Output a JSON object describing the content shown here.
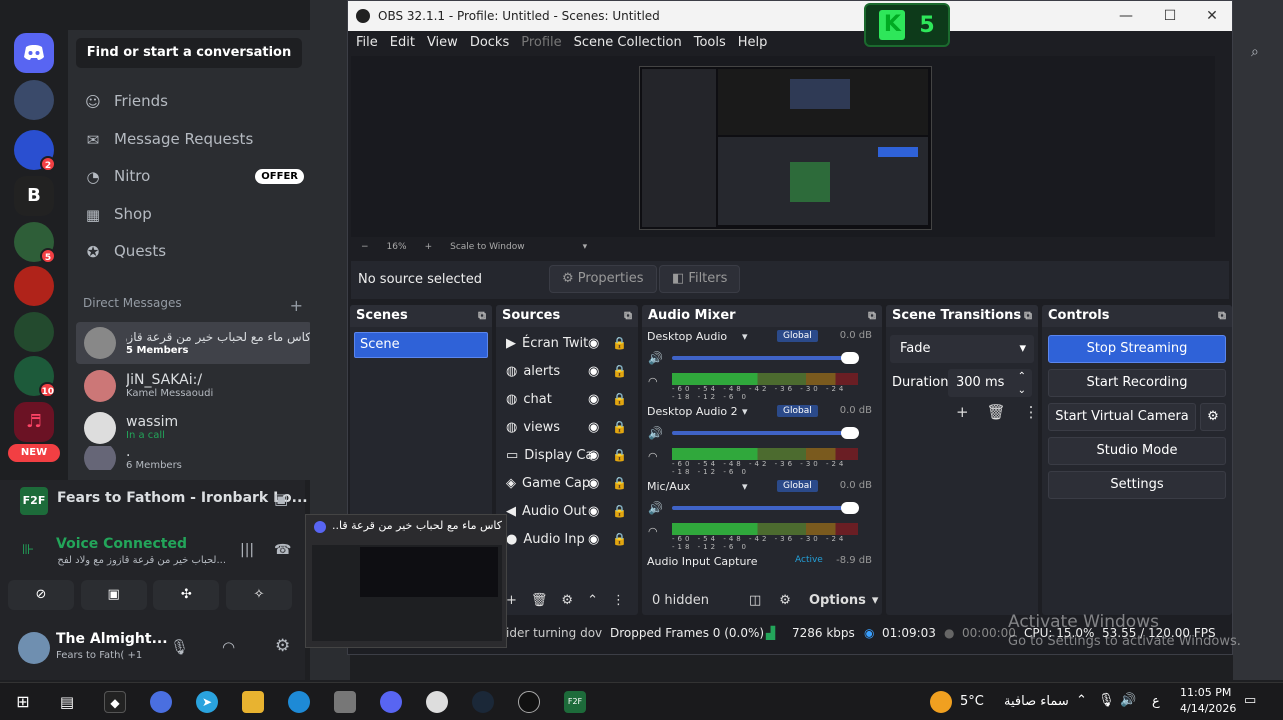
{
  "browser_nav": {
    "back": "←",
    "forward": "→"
  },
  "discord": {
    "search_label": "Find or start a conversation",
    "nav": [
      {
        "label": "Friends",
        "icon": "friends-icon"
      },
      {
        "label": "Message Requests",
        "icon": "mail-icon"
      },
      {
        "label": "Nitro",
        "icon": "nitro-icon",
        "badge": "OFFER"
      },
      {
        "label": "Shop",
        "icon": "shop-icon"
      },
      {
        "label": "Quests",
        "icon": "quests-icon"
      }
    ],
    "dm_header": "Direct Messages",
    "dm_add": "+",
    "dms": [
      {
        "name": "كاس ماء مع لحباب خير من قرعة قازوز مع ولاد لفح",
        "sub": "5 Members"
      },
      {
        "name": "JiN_SAKAi:/",
        "sub": "Kamel Messaoudi"
      },
      {
        "name": "wassim",
        "sub": "In a call"
      },
      {
        "name": ".",
        "sub": "6 Members"
      }
    ],
    "server_badges": [
      "2",
      "5",
      "10"
    ],
    "new_badge": "NEW",
    "activity": "Fears to Fathom - Ironbark Lo...",
    "activity_icon_text": "F2F",
    "voice_status": "Voice Connected",
    "voice_channel": "...لحباب خير من قرعة قازوز مع ولاد لفح",
    "user_name": "The Almight...",
    "user_status": "Fears to Fath( +1",
    "thumb_title": "كاس ماء مع لحباب خير من قرعة قا..."
  },
  "obs": {
    "title": "OBS 32.1.1 - Profile: Untitled - Scenes: Untitled",
    "menu": [
      "File",
      "Edit",
      "View",
      "Docks",
      "Profile",
      "Scene Collection",
      "Tools",
      "Help"
    ],
    "zoom": {
      "minus": "−",
      "value": "16%",
      "plus": "+",
      "fit": "Scale to Window"
    },
    "no_source": "No source selected",
    "properties": "Properties",
    "filters": "Filters",
    "scenes_title": "Scenes",
    "scenes": [
      "Scene"
    ],
    "sources_title": "Sources",
    "sources": [
      "Écran Twit",
      "alerts",
      "chat",
      "views",
      "Display Ca",
      "Game Cap",
      "Audio Out",
      "Audio Inp"
    ],
    "mixer_title": "Audio Mixer",
    "mixer": [
      {
        "name": "Desktop Audio",
        "tag": "Global",
        "db": "0.0 dB"
      },
      {
        "name": "Desktop Audio 2",
        "tag": "Global",
        "db": "0.0 dB"
      },
      {
        "name": "Mic/Aux",
        "tag": "Global",
        "db": "0.0 dB"
      }
    ],
    "mixer_last": {
      "name": "Audio Input Capture",
      "tag": "Active",
      "db": "-8.9 dB"
    },
    "meter_scale": "-60 -54 -48 -42 -36 -30 -24 -18 -12 -6 0",
    "hidden": "0 hidden",
    "options": "Options",
    "transitions_title": "Scene Transitions",
    "transition": "Fade",
    "duration_label": "Duration",
    "duration": "300 ms",
    "controls_title": "Controls",
    "controls": [
      "Stop Streaming",
      "Start Recording",
      "Start Virtual Camera",
      "Studio Mode",
      "Settings"
    ],
    "status": {
      "scrolling": "ider turning dov",
      "dropped": "Dropped Frames 0 (0.0%)",
      "kbps": "7286 kbps",
      "stream_time": "01:09:03",
      "rec_time": "00:00:00",
      "cpu": "CPU: 15.0%",
      "fps": "53.55 / 120.00 FPS"
    }
  },
  "overlay": {
    "k5": "5"
  },
  "watermark": {
    "line1": "Activate Windows",
    "line2": "Go to Settings to activate Windows."
  },
  "taskbar": {
    "temp": "5°C",
    "weather": "سماء صافية",
    "time": "11:05 PM",
    "date": "4/14/2026",
    "lang": "ع"
  },
  "colors": {
    "accent": "#2f62d8",
    "discord_blurple": "#5865f2",
    "green": "#23a55a"
  }
}
